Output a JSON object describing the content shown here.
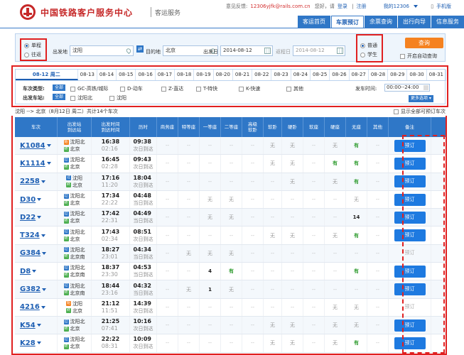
{
  "header": {
    "title": "中国铁路客户服务中心",
    "subtitle": "客运服务",
    "topbar": {
      "feedback_label": "意见反馈:",
      "feedback_email": "12306yjfk@rails.com.cn",
      "greeting": "您好，请",
      "login": "登录",
      "register": "注册",
      "my12306": "我的12306",
      "mobile": "手机版"
    },
    "nav": [
      "客运首页",
      "车票预订",
      "余票查询",
      "出行向导",
      "信息服务"
    ],
    "nav_active": 1
  },
  "search": {
    "trip_types": [
      "单程",
      "往返"
    ],
    "trip_selected": 0,
    "from_label": "出发地",
    "from_value": "沈阳",
    "to_label": "目的地",
    "to_value": "北京",
    "date_label": "出发日",
    "date_value": "2014-08-12",
    "return_label": "返程日",
    "return_value": "2014-08-12",
    "passenger_types": [
      "普通",
      "学生"
    ],
    "passenger_selected": 0,
    "query_button": "查询",
    "auto_query_label": "开启自动查询",
    "swap_icon": "swap-icon"
  },
  "filters": {
    "dates": [
      "08-12 周二",
      "08-13",
      "08-14",
      "08-15",
      "08-16",
      "08-17",
      "08-18",
      "08-19",
      "08-20",
      "08-21",
      "08-22",
      "08-23",
      "08-24",
      "08-25",
      "08-26",
      "08-27",
      "08-28",
      "08-29",
      "08-30",
      "08-31"
    ],
    "active_date": 0,
    "train_type_label": "车次类型:",
    "all_label": "全部",
    "train_types": [
      "GC-高铁/城际",
      "D-动车",
      "Z-直达",
      "T-特快",
      "K-快速",
      "其他"
    ],
    "station_label": "出发车站:",
    "stations": [
      "沈阳北",
      "沈阳"
    ],
    "depart_time_label": "发车时间:",
    "depart_time_value": "00:00--24:00",
    "more_options": "更多选项"
  },
  "result": {
    "route": "沈阳 --> 北京（8月12日 周二）共计14个车次",
    "show_all": "显示全部可预订车次"
  },
  "table": {
    "headers": [
      "车次",
      "出发站\n到达站",
      "出发时间\n到达时间",
      "历时",
      "商务座",
      "特等座",
      "一等座",
      "二等座",
      "高级\n软卧",
      "软卧",
      "硬卧",
      "软座",
      "硬座",
      "无座",
      "其他",
      "备注"
    ],
    "rows": [
      {
        "train": "K1084",
        "from": "沈阳北",
        "to": "北京",
        "from_tag": "始",
        "to_tag": "终",
        "dep": "16:38",
        "arr": "02:16",
        "dur": "09:38",
        "arr_day": "次日到达",
        "seats": [
          "--",
          "--",
          "--",
          "--",
          "--",
          "无",
          "无",
          "--",
          "无",
          "有",
          "--"
        ],
        "book": "预订",
        "bookable": true
      },
      {
        "train": "K1114",
        "from": "沈阳北",
        "to": "北京",
        "from_tag": "过",
        "to_tag": "终",
        "dep": "16:45",
        "arr": "02:28",
        "dur": "09:43",
        "arr_day": "次日到达",
        "seats": [
          "--",
          "--",
          "--",
          "--",
          "--",
          "无",
          "无",
          "--",
          "有",
          "有",
          "--"
        ],
        "book": "预订",
        "bookable": true
      },
      {
        "train": "2258",
        "from": "沈阳",
        "to": "北京",
        "from_tag": "过",
        "to_tag": "终",
        "dep": "17:16",
        "arr": "11:20",
        "dur": "18:04",
        "arr_day": "次日到达",
        "seats": [
          "--",
          "--",
          "--",
          "--",
          "--",
          "--",
          "无",
          "--",
          "无",
          "有",
          "--"
        ],
        "book": "预订",
        "bookable": true
      },
      {
        "train": "D30",
        "from": "沈阳北",
        "to": "北京",
        "from_tag": "过",
        "to_tag": "终",
        "dep": "17:34",
        "arr": "22:22",
        "dur": "04:48",
        "arr_day": "当日到达",
        "seats": [
          "--",
          "--",
          "无",
          "无",
          "--",
          "--",
          "--",
          "--",
          "--",
          "无",
          "--"
        ],
        "book": "预订",
        "bookable": true
      },
      {
        "train": "D22",
        "from": "沈阳北",
        "to": "北京",
        "from_tag": "过",
        "to_tag": "终",
        "dep": "17:42",
        "arr": "22:31",
        "dur": "04:49",
        "arr_day": "当日到达",
        "seats": [
          "--",
          "--",
          "无",
          "无",
          "--",
          "--",
          "--",
          "--",
          "--",
          "14",
          "--"
        ],
        "book": "预订",
        "bookable": true
      },
      {
        "train": "T324",
        "from": "沈阳北",
        "to": "北京",
        "from_tag": "过",
        "to_tag": "终",
        "dep": "17:43",
        "arr": "02:34",
        "dur": "08:51",
        "arr_day": "次日到达",
        "seats": [
          "--",
          "--",
          "--",
          "--",
          "--",
          "无",
          "无",
          "--",
          "无",
          "有",
          "--"
        ],
        "book": "预订",
        "bookable": true
      },
      {
        "train": "G384",
        "from": "沈阳北",
        "to": "北京南",
        "from_tag": "过",
        "to_tag": "终",
        "dep": "18:27",
        "arr": "23:01",
        "dur": "04:34",
        "arr_day": "当日到达",
        "seats": [
          "--",
          "无",
          "无",
          "无",
          "--",
          "--",
          "--",
          "--",
          "--",
          "--",
          "--"
        ],
        "book": "预订",
        "bookable": false
      },
      {
        "train": "D8",
        "from": "沈阳北",
        "to": "北京南",
        "from_tag": "过",
        "to_tag": "终",
        "dep": "18:37",
        "arr": "23:30",
        "dur": "04:53",
        "arr_day": "当日到达",
        "seats": [
          "--",
          "--",
          "4",
          "有",
          "--",
          "--",
          "--",
          "--",
          "--",
          "有",
          "--"
        ],
        "book": "预订",
        "bookable": true
      },
      {
        "train": "G382",
        "from": "沈阳北",
        "to": "北京南",
        "from_tag": "过",
        "to_tag": "终",
        "dep": "18:44",
        "arr": "23:16",
        "dur": "04:32",
        "arr_day": "当日到达",
        "seats": [
          "--",
          "无",
          "1",
          "无",
          "--",
          "--",
          "--",
          "--",
          "--",
          "--",
          "--"
        ],
        "book": "预订",
        "bookable": true
      },
      {
        "train": "4216",
        "from": "沈阳",
        "to": "北京",
        "from_tag": "始",
        "to_tag": "终",
        "dep": "21:12",
        "arr": "11:51",
        "dur": "14:39",
        "arr_day": "次日到达",
        "seats": [
          "--",
          "--",
          "--",
          "--",
          "--",
          "--",
          "--",
          "--",
          "无",
          "无",
          "--"
        ],
        "book": "预订",
        "bookable": false
      },
      {
        "train": "K54",
        "from": "沈阳北",
        "to": "北京",
        "from_tag": "过",
        "to_tag": "终",
        "dep": "21:25",
        "arr": "07:41",
        "dur": "10:16",
        "arr_day": "次日到达",
        "seats": [
          "--",
          "--",
          "--",
          "--",
          "--",
          "无",
          "无",
          "--",
          "无",
          "无",
          "--"
        ],
        "book": "预订",
        "bookable": true
      },
      {
        "train": "K28",
        "from": "沈阳北",
        "to": "北京",
        "from_tag": "过",
        "to_tag": "终",
        "dep": "22:22",
        "arr": "08:31",
        "dur": "10:09",
        "arr_day": "次日到达",
        "seats": [
          "--",
          "--",
          "--",
          "--",
          "--",
          "无",
          "无",
          "--",
          "无",
          "有",
          "--"
        ],
        "book": "预订",
        "bookable": true
      }
    ]
  },
  "colors": {
    "brand_red": "#c62828",
    "nav_blue": "#2f77c7",
    "book_blue": "#1e7ae0",
    "available_green": "#2e9b2e",
    "query_orange": "#f58220",
    "highlight_red": "#e02020"
  }
}
